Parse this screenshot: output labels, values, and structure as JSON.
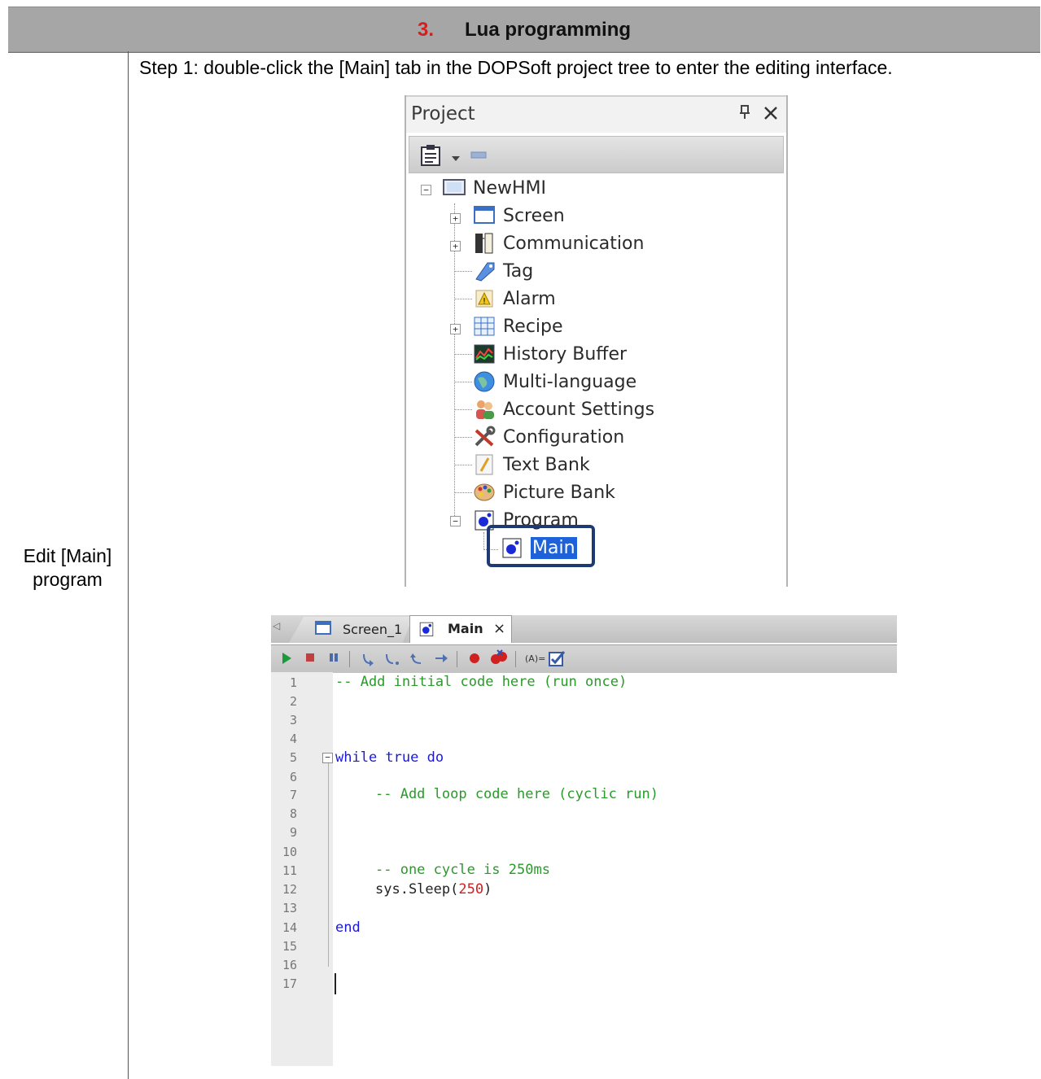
{
  "section": {
    "number": "3.",
    "title": "Lua programming"
  },
  "row_label": {
    "line1": "Edit [Main]",
    "line2": "program"
  },
  "step_text": "Step 1: double-click the [Main] tab in the DOPSoft project tree to enter the editing interface.",
  "project_panel": {
    "title": "Project",
    "pin_glyph": "ф",
    "close_glyph": "✕",
    "root": "NewHMI",
    "items": [
      {
        "label": "Screen",
        "icon": "screen-icon",
        "expandable": true
      },
      {
        "label": "Communication",
        "icon": "communication-icon",
        "expandable": true
      },
      {
        "label": "Tag",
        "icon": "tag-icon",
        "expandable": false
      },
      {
        "label": "Alarm",
        "icon": "alarm-icon",
        "expandable": false
      },
      {
        "label": "Recipe",
        "icon": "recipe-icon",
        "expandable": true
      },
      {
        "label": "History Buffer",
        "icon": "history-buffer-icon",
        "expandable": false
      },
      {
        "label": "Multi-language",
        "icon": "globe-icon",
        "expandable": false
      },
      {
        "label": "Account Settings",
        "icon": "users-icon",
        "expandable": false
      },
      {
        "label": "Configuration",
        "icon": "tools-icon",
        "expandable": false
      },
      {
        "label": "Text Bank",
        "icon": "text-bank-icon",
        "expandable": false
      },
      {
        "label": "Picture Bank",
        "icon": "palette-icon",
        "expandable": false
      },
      {
        "label": "Program",
        "icon": "program-icon",
        "expandable": true,
        "expanded": true
      }
    ],
    "child": {
      "label": "Main",
      "icon": "program-icon",
      "selected": true
    },
    "highlight_color": "#1f3a73",
    "selection_color": "#1d62d9"
  },
  "editor": {
    "tabs": [
      {
        "label": "Screen_1",
        "active": false
      },
      {
        "label": "Main",
        "active": true,
        "close": "×"
      }
    ],
    "line_numbers": [
      "1",
      "2",
      "3",
      "4",
      "5",
      "6",
      "7",
      "8",
      "9",
      "10",
      "11",
      "12",
      "13",
      "14",
      "15",
      "16",
      "17"
    ],
    "code": {
      "l1": "-- Add initial code here (run once)",
      "l5_kw": "while true do",
      "l7": "-- Add loop code here (cyclic run)",
      "l11": "-- one cycle is 250ms",
      "l12_a": "sys.Sleep(",
      "l12_num": "250",
      "l12_b": ")",
      "l14": "end"
    },
    "colors": {
      "comment": "#2a9a2a",
      "keyword": "#1a1ad6",
      "number": "#d02020"
    }
  }
}
